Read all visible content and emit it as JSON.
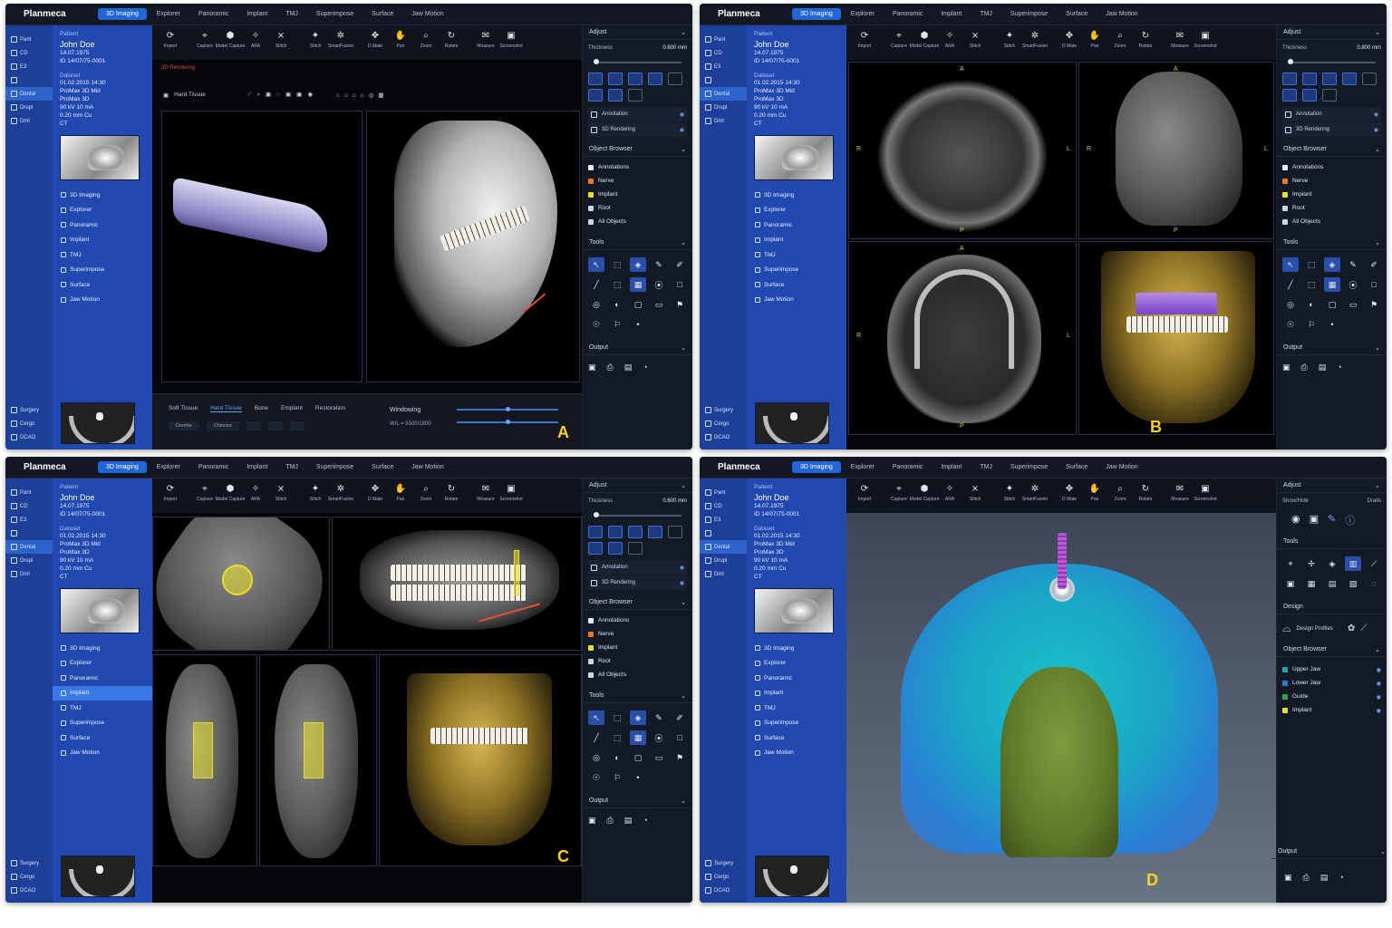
{
  "app": {
    "brand": "Planmeca",
    "modules": [
      "3D Imaging",
      "Explorer",
      "Panoramic",
      "Implant",
      "TMJ",
      "Superimpose",
      "Surface",
      "Jaw Motion"
    ]
  },
  "iconbar": {
    "items": [
      "Pant",
      "CD",
      "E3",
      "",
      "Dental",
      "Drupl",
      "Dml"
    ],
    "bottom": [
      "Surgery",
      "Cergo",
      "DCAO"
    ]
  },
  "patient": {
    "label": "Patient",
    "name": "John Doe",
    "dob": "14.07.1975",
    "id": "ID 14/07/75-0001"
  },
  "dataset": {
    "label": "Dataset",
    "lines": [
      "01.02.2015 14:30",
      "ProMax 3D Mid",
      "ProMax 3D",
      "90 kV 10 mA",
      "0.20 mm Cu",
      "CT"
    ]
  },
  "sidebar_menu": [
    "3D Imaging",
    "Explorer",
    "Panoramic",
    "Implant",
    "TMJ",
    "Superimpose",
    "Surface",
    "Jaw Motion"
  ],
  "toolbar": [
    {
      "label": "Import",
      "icon": "⟳"
    },
    {
      "label": "Capture",
      "icon": "⌖"
    },
    {
      "label": "Model Capture",
      "icon": "⬢"
    },
    {
      "label": "ARA",
      "icon": "✧"
    },
    {
      "label": "Stitch",
      "icon": "⨯"
    },
    {
      "label": "Stitch",
      "icon": "✦"
    },
    {
      "label": "SmartFusion",
      "icon": "✲"
    },
    {
      "label": "D Mate",
      "icon": "✥"
    },
    {
      "label": "Pan",
      "icon": "✋"
    },
    {
      "label": "Zoom",
      "icon": "⌕"
    },
    {
      "label": "Rotate",
      "icon": "↻"
    },
    {
      "label": "Measure",
      "icon": "✉"
    },
    {
      "label": "Screenshot",
      "icon": "▣"
    }
  ],
  "adjust": {
    "title": "Adjust",
    "thickness_label": "Thickness",
    "thickness_a": "0.600 mm",
    "thickness_b": "0.800 mm",
    "thickness_c": "0.600 mm"
  },
  "layers": [
    {
      "label": "Annotation",
      "eye": "◉"
    },
    {
      "label": "3D Rendering",
      "eye": "◉"
    }
  ],
  "object_browser": {
    "title": "Object Browser",
    "items": [
      {
        "label": "Annotations",
        "color": "#e8ecf2"
      },
      {
        "label": "Nerve",
        "color": "#e8792a"
      },
      {
        "label": "Implant",
        "color": "#e8df2a"
      },
      {
        "label": "Root",
        "color": "#cfd6e4"
      },
      {
        "label": "All Objects",
        "color": "#cfd6e4"
      }
    ]
  },
  "tools_title": "Tools",
  "tools": [
    "↖",
    "⬚",
    "◈",
    "✎",
    "✐",
    "╱",
    "⬚",
    "▦",
    "⦿",
    "□",
    "◎",
    "◐",
    "▢",
    "▭",
    "⚑",
    "☉",
    "⚐",
    "•"
  ],
  "output_title": "Output",
  "output_icons": [
    "▣",
    "⎙",
    "▤",
    "◔"
  ],
  "panel_a": {
    "letter": "A",
    "view_title": "3D Rendering",
    "preset": "Hard Tissue",
    "tissue_tabs": [
      "Soft Tissue",
      "Hard Tissue",
      "Bone",
      "Emplant",
      "Restoration"
    ],
    "sub_buttons": [
      "Denthe",
      "Chinnes",
      "",
      "",
      ""
    ],
    "windowing_label": "Windowing",
    "wl": "W/L = 5500/1800"
  },
  "panel_b": {
    "letter": "B",
    "orient": {
      "a": "A",
      "p": "P",
      "r": "R",
      "l": "L"
    }
  },
  "panel_c": {
    "letter": "C"
  },
  "panel_d": {
    "letter": "D",
    "adjust_title": "Adjust",
    "show_hide": "Show/Hide",
    "show_hide2": "Dralls",
    "tools_title": "Tools",
    "design_title": "Design",
    "design_item": "Design Profiles",
    "object_browser_title": "Object Browser",
    "objects": [
      {
        "label": "Upper Jaw",
        "color": "#26a3a8"
      },
      {
        "label": "Lower Jaw",
        "color": "#2c7cc9"
      },
      {
        "label": "Guide",
        "color": "#3aa14a"
      },
      {
        "label": "Implant",
        "color": "#e8df2a"
      }
    ]
  }
}
